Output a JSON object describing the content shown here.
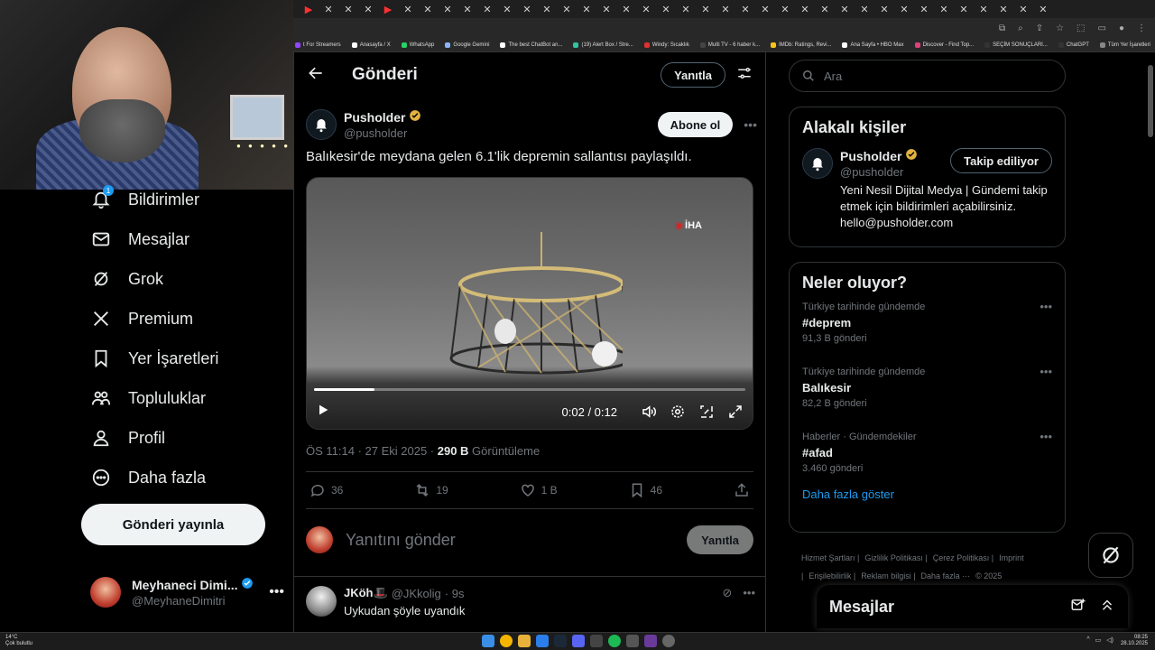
{
  "colors": {
    "accent": "#1d9bf0",
    "verified_gold": "#e3b341",
    "background": "#000000"
  },
  "browser": {
    "bookmarks": [
      {
        "label": "t For Streamers",
        "color": "#9146ff"
      },
      {
        "label": "Anasayfa / X",
        "color": "#ffffff"
      },
      {
        "label": "WhatsApp",
        "color": "#25d366"
      },
      {
        "label": "Google Gemini",
        "color": "#8ab4f8"
      },
      {
        "label": "The best ChatBot an...",
        "color": "#ffffff"
      },
      {
        "label": "(19) Alert Box / Stre...",
        "color": "#31c3a2"
      },
      {
        "label": "Windy: Sıcaklık",
        "color": "#e03030"
      },
      {
        "label": "Multi TV - 6 haber k...",
        "color": "#444444"
      },
      {
        "label": "IMDb: Ratings, Revi...",
        "color": "#f5c518"
      },
      {
        "label": "Ana Sayfa • HBO Max",
        "color": "#ffffff"
      },
      {
        "label": "Discover - Find Top...",
        "color": "#e0407a"
      },
      {
        "label": "SEÇİM SONUÇLARI...",
        "color": "#333333"
      },
      {
        "label": "ChatGPT",
        "color": "#333333"
      },
      {
        "label": "Tüm Yer İşaretleri",
        "color": "#888888"
      }
    ]
  },
  "nav": {
    "notification_count": "1",
    "items": [
      {
        "label": "Bildirimler",
        "icon": "bell-icon"
      },
      {
        "label": "Mesajlar",
        "icon": "mail-icon"
      },
      {
        "label": "Grok",
        "icon": "grok-icon"
      },
      {
        "label": "Premium",
        "icon": "x-logo-icon"
      },
      {
        "label": "Yer İşaretleri",
        "icon": "bookmark-icon"
      },
      {
        "label": "Topluluklar",
        "icon": "people-icon"
      },
      {
        "label": "Profil",
        "icon": "person-icon"
      },
      {
        "label": "Daha fazla",
        "icon": "more-circle-icon"
      }
    ],
    "post_button": "Gönderi yayınla",
    "profile": {
      "name": "Meyhaneci Dimi...",
      "handle": "@MeyhaneDimitri"
    }
  },
  "main": {
    "title": "Gönderi",
    "reply_label": "Yanıtla",
    "author": {
      "name": "Pusholder",
      "handle": "@pusholder"
    },
    "follow_label": "Abone ol",
    "tweet_text": "Balıkesir'de meydana gelen 6.1'lik depremin sallantısı paylaşıldı.",
    "video": {
      "watermark": "İHA",
      "time": "0:02 / 0:12",
      "progress": 0.14
    },
    "meta": {
      "time": "ÖS 11:14 · 27 Eki 2025 · ",
      "views": "290 B",
      "views_label": " Görüntüleme"
    },
    "actions": {
      "replies": "36",
      "reposts": "19",
      "likes": "1 B",
      "bookmarks": "46"
    },
    "reply_placeholder": "Yanıtını gönder",
    "reply_button": "Yanıtla",
    "comment": {
      "name": "JKöh🎩",
      "handle": "@JKkolig",
      "time": "· 9s",
      "text": "Uykudan şöyle uyandık"
    }
  },
  "right": {
    "search_placeholder": "Ara",
    "related_title": "Alakalı kişiler",
    "related": {
      "name": "Pusholder",
      "handle": "@pusholder",
      "button": "Takip ediliyor",
      "bio": "Yeni Nesil Dijital Medya | Gündemi takip etmek için bildirimleri açabilirsiniz. hello@pusholder.com"
    },
    "trends_title": "Neler oluyor?",
    "trends": [
      {
        "context": "Türkiye tarihinde gündemde",
        "tag": "#deprem",
        "count": "91,3 B gönderi"
      },
      {
        "context": "Türkiye tarihinde gündemde",
        "tag": "Balıkesir",
        "count": "82,2 B gönderi"
      },
      {
        "context": "Haberler · Gündemdekiler",
        "tag": "#afad",
        "count": "3.460 gönderi"
      }
    ],
    "show_more": "Daha fazla göster",
    "footer": [
      "Hizmet Şartları |",
      "Gizlilik Politikası |",
      "Çerez Politikası |",
      "Imprint |",
      "Erişilebilirlik |",
      "Reklam bilgisi |",
      "Daha fazla ···",
      "© 2025"
    ],
    "messages_dock": "Mesajlar"
  },
  "taskbar": {
    "temp": "14°C",
    "weather": "Çok bulutlu",
    "time": "08:25",
    "date": "28.10.2025"
  }
}
